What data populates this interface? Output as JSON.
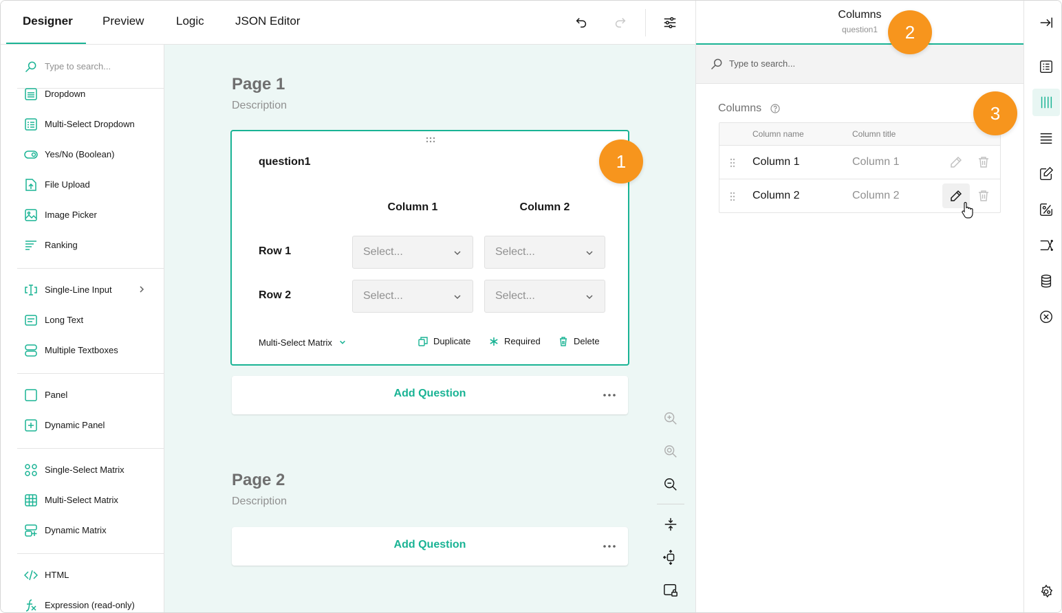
{
  "tabs": [
    {
      "label": "Designer",
      "active": true
    },
    {
      "label": "Preview"
    },
    {
      "label": "Logic"
    },
    {
      "label": "JSON Editor"
    }
  ],
  "toolbox": {
    "search_placeholder": "Type to search...",
    "items": [
      {
        "label": "Dropdown",
        "icon": "dropdown-icon"
      },
      {
        "label": "Multi-Select Dropdown",
        "icon": "multi-select-dropdown-icon"
      },
      {
        "label": "Yes/No (Boolean)",
        "icon": "toggle-icon"
      },
      {
        "label": "File Upload",
        "icon": "file-upload-icon"
      },
      {
        "label": "Image Picker",
        "icon": "image-picker-icon"
      },
      {
        "label": "Ranking",
        "icon": "ranking-icon"
      },
      {
        "label": "Single-Line Input",
        "icon": "text-input-icon"
      },
      {
        "label": "Long Text",
        "icon": "long-text-icon"
      },
      {
        "label": "Multiple Textboxes",
        "icon": "multiple-textboxes-icon"
      },
      {
        "label": "Panel",
        "icon": "panel-icon"
      },
      {
        "label": "Dynamic Panel",
        "icon": "dynamic-panel-icon"
      },
      {
        "label": "Single-Select Matrix",
        "icon": "single-matrix-icon"
      },
      {
        "label": "Multi-Select Matrix",
        "icon": "multi-matrix-icon"
      },
      {
        "label": "Dynamic Matrix",
        "icon": "dynamic-matrix-icon"
      },
      {
        "label": "HTML",
        "icon": "html-icon"
      },
      {
        "label": "Expression (read-only)",
        "icon": "expression-icon"
      }
    ]
  },
  "pages": [
    {
      "title": "Page 1",
      "description": "Description"
    },
    {
      "title": "Page 2",
      "description": "Description"
    }
  ],
  "question": {
    "name": "question1",
    "columns": [
      "Column 1",
      "Column 2"
    ],
    "rows": [
      "Row 1",
      "Row 2"
    ],
    "select_placeholder": "Select...",
    "type": "Multi-Select Matrix",
    "actions": {
      "duplicate": "Duplicate",
      "required": "Required",
      "delete": "Delete"
    }
  },
  "add_question_label": "Add Question",
  "property_grid": {
    "title": "Columns",
    "subtitle": "question1",
    "search_placeholder": "Type to search...",
    "section_label": "Columns",
    "table_headers": [
      "Column name",
      "Column title"
    ],
    "rows": [
      {
        "name": "Column 1",
        "title": "Column 1"
      },
      {
        "name": "Column 2",
        "title": "Column 2"
      }
    ]
  },
  "callouts": [
    "1",
    "2",
    "3"
  ],
  "colors": {
    "accent": "#19b394",
    "callout": "#f7951d"
  }
}
